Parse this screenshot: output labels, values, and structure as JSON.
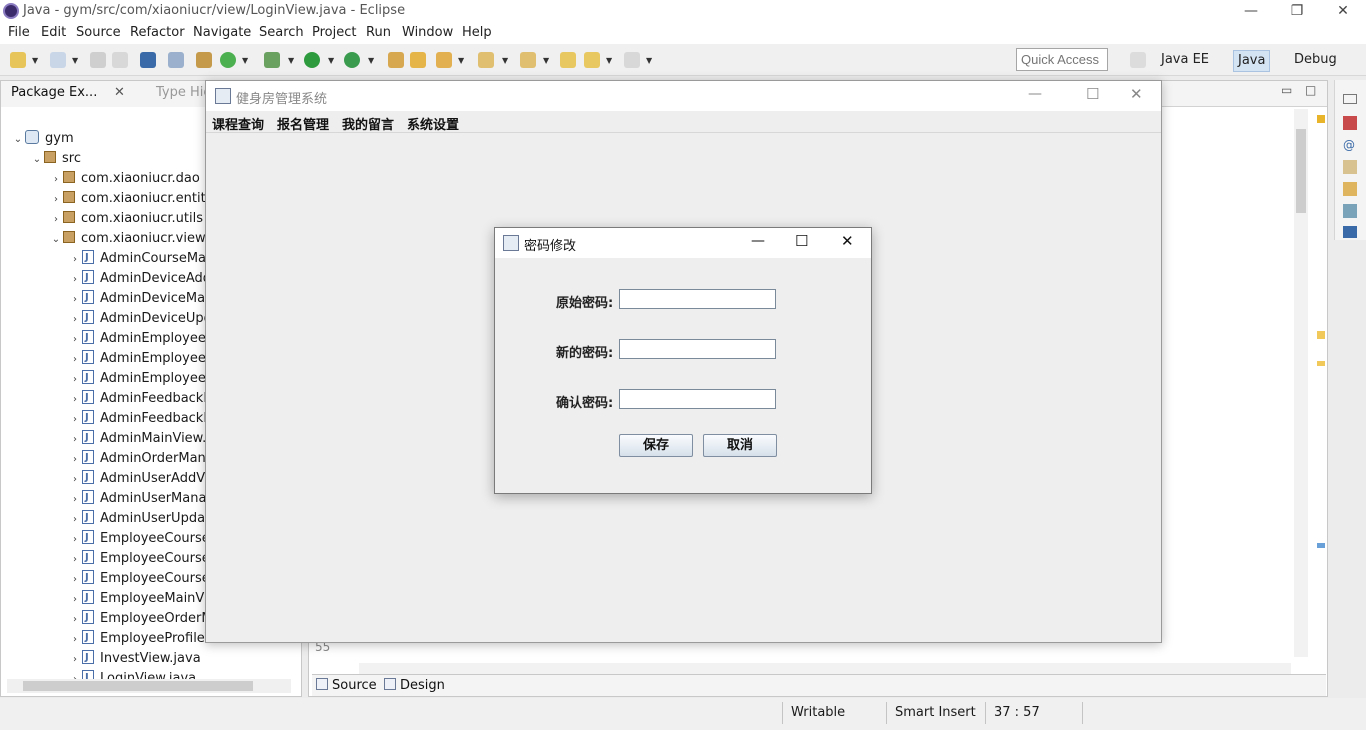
{
  "eclipse": {
    "window_title": "Java - gym/src/com/xiaoniucr/view/LoginView.java - Eclipse",
    "window_controls": {
      "minimize": "—",
      "restore": "❐",
      "close": "✕"
    },
    "menus": [
      "File",
      "Edit",
      "Source",
      "Refactor",
      "Navigate",
      "Search",
      "Project",
      "Run",
      "Window",
      "Help"
    ],
    "quick_access_placeholder": "Quick Access",
    "perspectives": [
      "Java EE",
      "Java",
      "Debug"
    ]
  },
  "package_explorer": {
    "tab_label": "Package Ex...",
    "tab2_label": "Type Hie",
    "project": "gym",
    "src_folder": "src",
    "packages": [
      "com.xiaoniucr.dao",
      "com.xiaoniucr.entity",
      "com.xiaoniucr.utils",
      "com.xiaoniucr.view"
    ],
    "files": [
      "AdminCourseMan",
      "AdminDeviceAdd",
      "AdminDeviceMan",
      "AdminDeviceUpd",
      "AdminEmployeeA",
      "AdminEmployeeM",
      "AdminEmployeeU",
      "AdminFeedbackM",
      "AdminFeedbackR",
      "AdminMainView.j",
      "AdminOrderMan",
      "AdminUserAddVi",
      "AdminUserManag",
      "AdminUserUpdat",
      "EmployeeCourse",
      "EmployeeCourse",
      "EmployeeCourse",
      "EmployeeMainVie",
      "EmployeeOrderM",
      "EmployeeProfileV",
      "InvestView.java",
      "LoginView.java"
    ]
  },
  "editor": {
    "line_number": "55",
    "bottom_tabs": [
      "Source",
      "Design"
    ]
  },
  "status_bar": {
    "mode": "Writable",
    "insert": "Smart Insert",
    "position": "37 : 57"
  },
  "gym_app": {
    "title": "健身房管理系统",
    "menus": [
      "课程查询",
      "报名管理",
      "我的留言",
      "系统设置"
    ]
  },
  "password_dialog": {
    "title": "密码修改",
    "fields": [
      {
        "label": "原始密码:",
        "value": ""
      },
      {
        "label": "新的密码:",
        "value": ""
      },
      {
        "label": "确认密码:",
        "value": ""
      }
    ],
    "save_label": "保存",
    "cancel_label": "取消"
  }
}
